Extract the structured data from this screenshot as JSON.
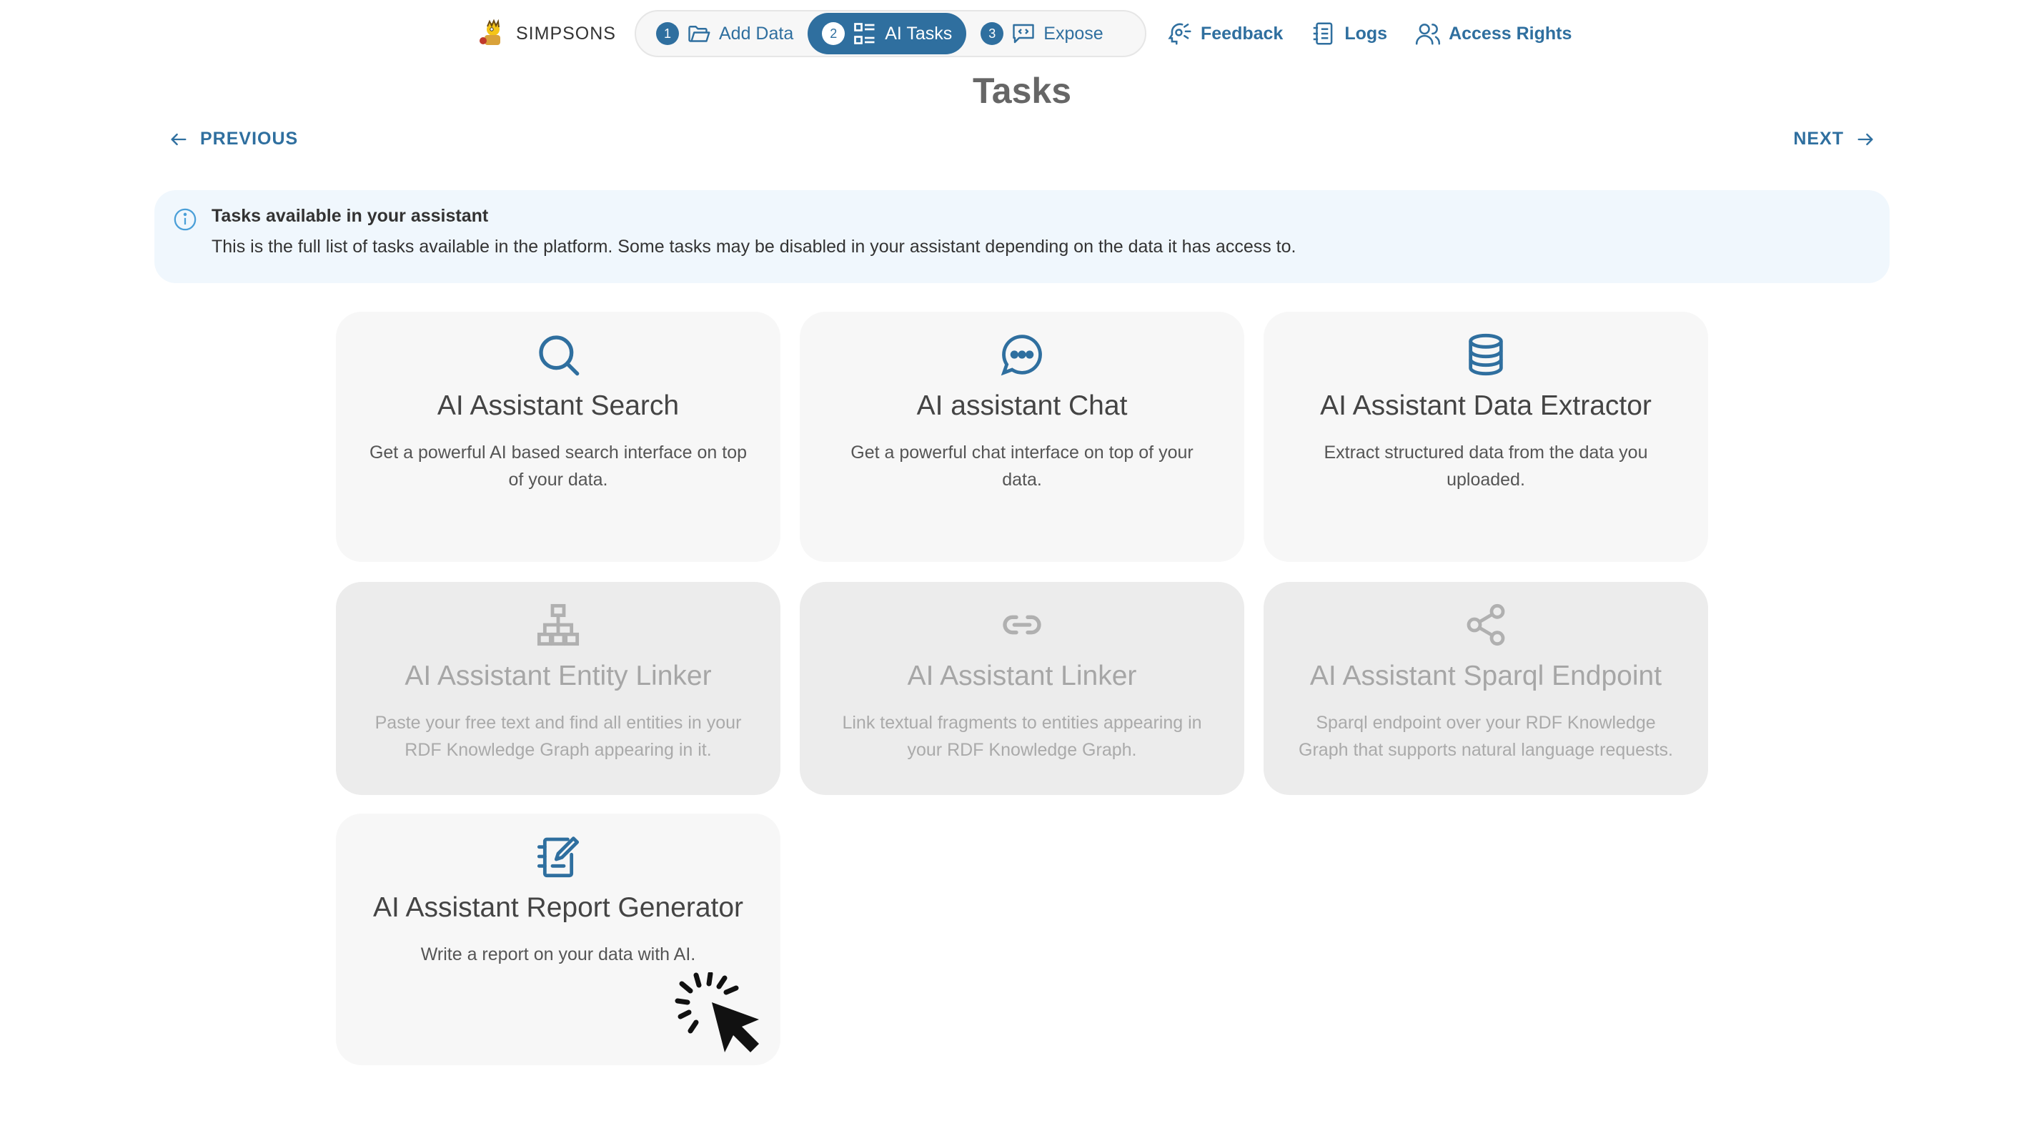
{
  "header": {
    "brand": "SIMPSONS",
    "steps": [
      {
        "num": "1",
        "label": "Add Data",
        "icon": "folder-open-icon"
      },
      {
        "num": "2",
        "label": "AI Tasks",
        "icon": "list-grid-icon"
      },
      {
        "num": "3",
        "label": "Expose",
        "icon": "code-message-icon"
      }
    ],
    "links": [
      {
        "label": "Feedback",
        "icon": "feedback-icon"
      },
      {
        "label": "Logs",
        "icon": "notebook-icon"
      },
      {
        "label": "Access Rights",
        "icon": "users-icon"
      }
    ]
  },
  "page": {
    "title": "Tasks",
    "prev_label": "PREVIOUS",
    "next_label": "NEXT"
  },
  "info": {
    "title": "Tasks available in your assistant",
    "text": "This is the full list of tasks available in the platform. Some tasks may be disabled in your assistant depending on the data it has access to."
  },
  "cards": [
    {
      "title": "AI Assistant Search",
      "desc": "Get a powerful AI based search interface on top of your data.",
      "icon": "search-icon",
      "enabled": true
    },
    {
      "title": "AI assistant Chat",
      "desc": "Get a powerful chat interface on top of your data.",
      "icon": "chat-icon",
      "enabled": true
    },
    {
      "title": "AI Assistant Data Extractor",
      "desc": "Extract structured data from the data you uploaded.",
      "icon": "database-icon",
      "enabled": true
    },
    {
      "title": "AI Assistant Entity Linker",
      "desc": "Paste your free text and find all entities in your RDF Knowledge Graph appearing in it.",
      "icon": "hierarchy-icon",
      "enabled": false
    },
    {
      "title": "AI Assistant Linker",
      "desc": "Link textual fragments to entities appearing in your RDF Knowledge Graph.",
      "icon": "link-icon",
      "enabled": false
    },
    {
      "title": "AI Assistant Sparql Endpoint",
      "desc": "Sparql endpoint over your RDF Knowledge Graph that supports natural language requests.",
      "icon": "share-icon",
      "enabled": false
    },
    {
      "title": "AI Assistant Report Generator",
      "desc": "Write a report on your data with AI.",
      "icon": "report-edit-icon",
      "enabled": true
    }
  ],
  "colors": {
    "accent": "#2f6f9f",
    "card_bg": "#f7f7f7",
    "card_disabled_bg": "#ececec",
    "info_bg": "#f0f7fd"
  }
}
